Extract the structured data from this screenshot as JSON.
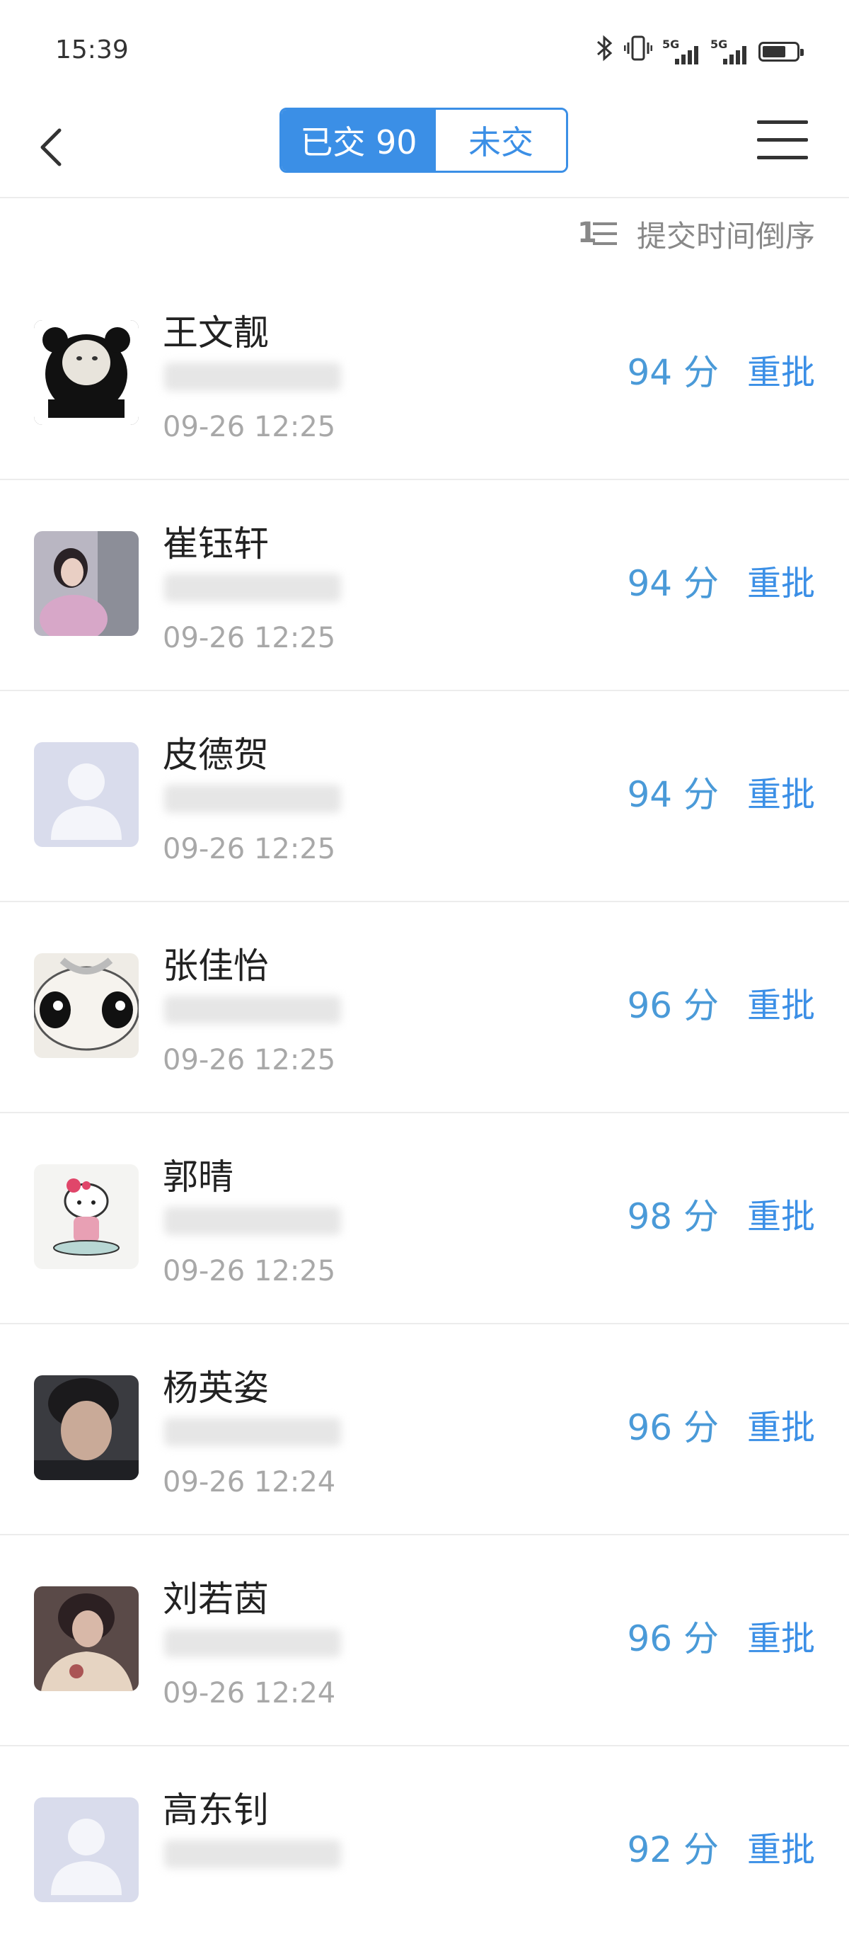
{
  "status_bar": {
    "time": "15:39",
    "network_1": "5G",
    "network_2": "5G"
  },
  "header": {
    "tab_submitted": "已交 90",
    "tab_not_submitted": "未交",
    "accent_color": "#3b8fe6"
  },
  "sort": {
    "label": "提交时间倒序",
    "icon": "1三"
  },
  "students": [
    {
      "name": "王文靓",
      "time": "09-26 12:25",
      "score": "94 分",
      "action": "重批"
    },
    {
      "name": "崔钰轩",
      "time": "09-26 12:25",
      "score": "94 分",
      "action": "重批"
    },
    {
      "name": "皮德贺",
      "time": "09-26 12:25",
      "score": "94 分",
      "action": "重批"
    },
    {
      "name": "张佳怡",
      "time": "09-26 12:25",
      "score": "96 分",
      "action": "重批"
    },
    {
      "name": "郭晴",
      "time": "09-26 12:25",
      "score": "98 分",
      "action": "重批"
    },
    {
      "name": "杨英姿",
      "time": "09-26 12:24",
      "score": "96 分",
      "action": "重批"
    },
    {
      "name": "刘若茵",
      "time": "09-26 12:24",
      "score": "96 分",
      "action": "重批"
    },
    {
      "name": "高东钊",
      "time": "",
      "score": "92 分",
      "action": "重批"
    }
  ]
}
